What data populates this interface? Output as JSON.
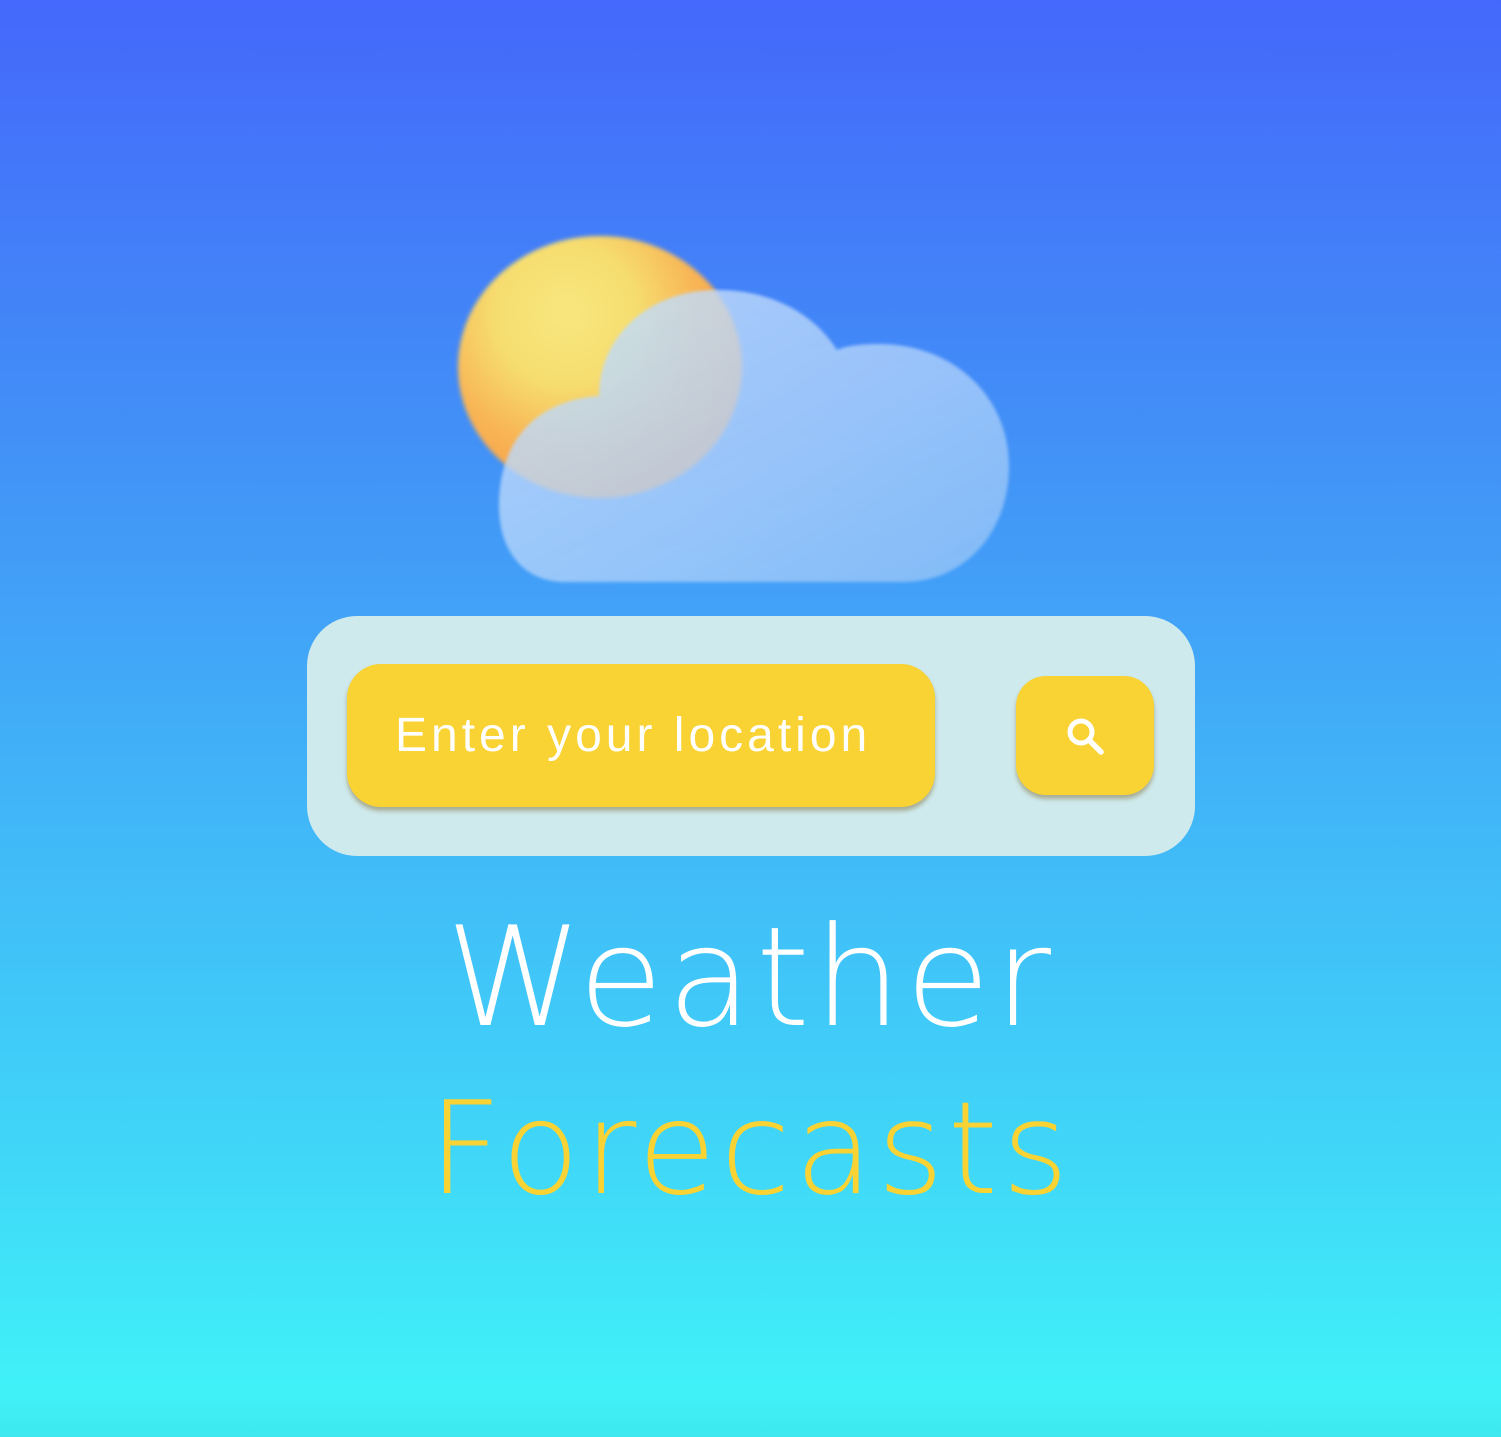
{
  "search": {
    "placeholder": "Enter your location",
    "button_icon": "search-icon"
  },
  "title": {
    "line1": "Weather",
    "line2": "Forecasts"
  },
  "hero_icon": "partly-cloudy-icon",
  "colors": {
    "background_top": "#4468fb",
    "background_bottom": "#40f2f8",
    "accent_yellow": "#f9d233",
    "panel": "#cfeaed",
    "title_white": "#ffffff"
  }
}
